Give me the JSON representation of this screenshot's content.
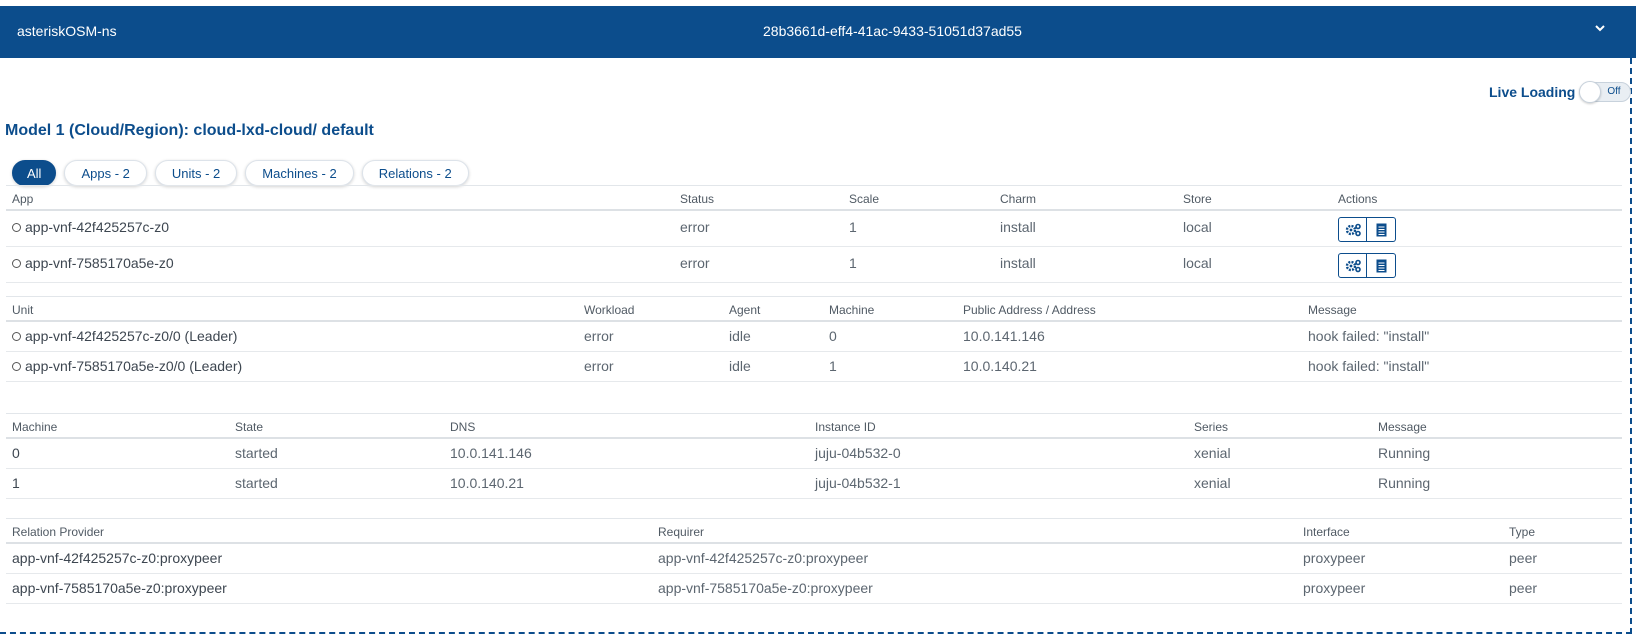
{
  "header": {
    "ns_name": "asteriskOSM-ns",
    "ns_id": "28b3661d-eff4-41ac-9433-51051d37ad55",
    "expand_icon": "chevron-down-icon"
  },
  "live_loading": {
    "label": "Live Loading",
    "state": "Off",
    "enabled": false
  },
  "model_title": "Model 1 (Cloud/Region): cloud-lxd-cloud/ default",
  "filters": [
    "All",
    "Apps - 2",
    "Units - 2",
    "Machines - 2",
    "Relations - 2"
  ],
  "active_filter": "All",
  "colors": {
    "brand": "#0c4d8c",
    "header_text": "#ffffff"
  },
  "apps": {
    "headers": [
      "App",
      "Status",
      "Scale",
      "Charm",
      "Store",
      "Actions"
    ],
    "rows": [
      {
        "app": "app-vnf-42f425257c-z0",
        "status": "error",
        "scale": "1",
        "charm": "install",
        "store": "local"
      },
      {
        "app": "app-vnf-7585170a5e-z0",
        "status": "error",
        "scale": "1",
        "charm": "install",
        "store": "local"
      }
    ],
    "action_icons": [
      "gears-icon",
      "log-icon"
    ]
  },
  "units": {
    "headers": [
      "Unit",
      "Workload",
      "Agent",
      "Machine",
      "Public Address / Address",
      "Message"
    ],
    "rows": [
      {
        "unit": "app-vnf-42f425257c-z0/0 (Leader)",
        "workload": "error",
        "agent": "idle",
        "machine": "0",
        "address": "10.0.141.146",
        "message": "hook failed: \"install\""
      },
      {
        "unit": "app-vnf-7585170a5e-z0/0 (Leader)",
        "workload": "error",
        "agent": "idle",
        "machine": "1",
        "address": "10.0.140.21",
        "message": "hook failed: \"install\""
      }
    ]
  },
  "machines": {
    "headers": [
      "Machine",
      "State",
      "DNS",
      "Instance ID",
      "Series",
      "Message"
    ],
    "rows": [
      {
        "machine": "0",
        "state": "started",
        "dns": "10.0.141.146",
        "instance_id": "juju-04b532-0",
        "series": "xenial",
        "message": "Running"
      },
      {
        "machine": "1",
        "state": "started",
        "dns": "10.0.140.21",
        "instance_id": "juju-04b532-1",
        "series": "xenial",
        "message": "Running"
      }
    ]
  },
  "relations": {
    "headers": [
      "Relation Provider",
      "Requirer",
      "Interface",
      "Type"
    ],
    "rows": [
      {
        "provider": "app-vnf-42f425257c-z0:proxypeer",
        "requirer": "app-vnf-42f425257c-z0:proxypeer",
        "interface": "proxypeer",
        "type": "peer"
      },
      {
        "provider": "app-vnf-7585170a5e-z0:proxypeer",
        "requirer": "app-vnf-7585170a5e-z0:proxypeer",
        "interface": "proxypeer",
        "type": "peer"
      }
    ]
  }
}
